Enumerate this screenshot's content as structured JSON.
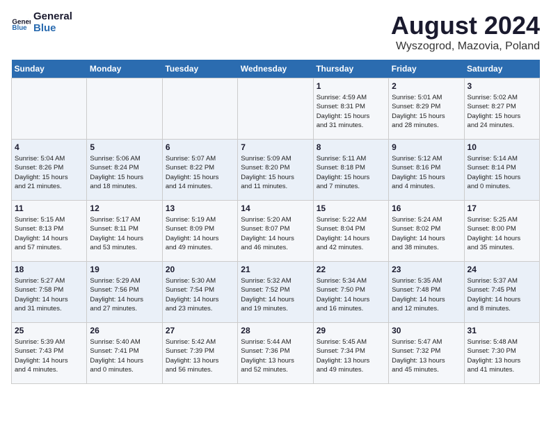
{
  "header": {
    "logo_line1": "General",
    "logo_line2": "Blue",
    "main_title": "August 2024",
    "sub_title": "Wyszogrod, Mazovia, Poland"
  },
  "weekdays": [
    "Sunday",
    "Monday",
    "Tuesday",
    "Wednesday",
    "Thursday",
    "Friday",
    "Saturday"
  ],
  "weeks": [
    [
      {
        "day": "",
        "info": ""
      },
      {
        "day": "",
        "info": ""
      },
      {
        "day": "",
        "info": ""
      },
      {
        "day": "",
        "info": ""
      },
      {
        "day": "1",
        "info": "Sunrise: 4:59 AM\nSunset: 8:31 PM\nDaylight: 15 hours\nand 31 minutes."
      },
      {
        "day": "2",
        "info": "Sunrise: 5:01 AM\nSunset: 8:29 PM\nDaylight: 15 hours\nand 28 minutes."
      },
      {
        "day": "3",
        "info": "Sunrise: 5:02 AM\nSunset: 8:27 PM\nDaylight: 15 hours\nand 24 minutes."
      }
    ],
    [
      {
        "day": "4",
        "info": "Sunrise: 5:04 AM\nSunset: 8:26 PM\nDaylight: 15 hours\nand 21 minutes."
      },
      {
        "day": "5",
        "info": "Sunrise: 5:06 AM\nSunset: 8:24 PM\nDaylight: 15 hours\nand 18 minutes."
      },
      {
        "day": "6",
        "info": "Sunrise: 5:07 AM\nSunset: 8:22 PM\nDaylight: 15 hours\nand 14 minutes."
      },
      {
        "day": "7",
        "info": "Sunrise: 5:09 AM\nSunset: 8:20 PM\nDaylight: 15 hours\nand 11 minutes."
      },
      {
        "day": "8",
        "info": "Sunrise: 5:11 AM\nSunset: 8:18 PM\nDaylight: 15 hours\nand 7 minutes."
      },
      {
        "day": "9",
        "info": "Sunrise: 5:12 AM\nSunset: 8:16 PM\nDaylight: 15 hours\nand 4 minutes."
      },
      {
        "day": "10",
        "info": "Sunrise: 5:14 AM\nSunset: 8:14 PM\nDaylight: 15 hours\nand 0 minutes."
      }
    ],
    [
      {
        "day": "11",
        "info": "Sunrise: 5:15 AM\nSunset: 8:13 PM\nDaylight: 14 hours\nand 57 minutes."
      },
      {
        "day": "12",
        "info": "Sunrise: 5:17 AM\nSunset: 8:11 PM\nDaylight: 14 hours\nand 53 minutes."
      },
      {
        "day": "13",
        "info": "Sunrise: 5:19 AM\nSunset: 8:09 PM\nDaylight: 14 hours\nand 49 minutes."
      },
      {
        "day": "14",
        "info": "Sunrise: 5:20 AM\nSunset: 8:07 PM\nDaylight: 14 hours\nand 46 minutes."
      },
      {
        "day": "15",
        "info": "Sunrise: 5:22 AM\nSunset: 8:04 PM\nDaylight: 14 hours\nand 42 minutes."
      },
      {
        "day": "16",
        "info": "Sunrise: 5:24 AM\nSunset: 8:02 PM\nDaylight: 14 hours\nand 38 minutes."
      },
      {
        "day": "17",
        "info": "Sunrise: 5:25 AM\nSunset: 8:00 PM\nDaylight: 14 hours\nand 35 minutes."
      }
    ],
    [
      {
        "day": "18",
        "info": "Sunrise: 5:27 AM\nSunset: 7:58 PM\nDaylight: 14 hours\nand 31 minutes."
      },
      {
        "day": "19",
        "info": "Sunrise: 5:29 AM\nSunset: 7:56 PM\nDaylight: 14 hours\nand 27 minutes."
      },
      {
        "day": "20",
        "info": "Sunrise: 5:30 AM\nSunset: 7:54 PM\nDaylight: 14 hours\nand 23 minutes."
      },
      {
        "day": "21",
        "info": "Sunrise: 5:32 AM\nSunset: 7:52 PM\nDaylight: 14 hours\nand 19 minutes."
      },
      {
        "day": "22",
        "info": "Sunrise: 5:34 AM\nSunset: 7:50 PM\nDaylight: 14 hours\nand 16 minutes."
      },
      {
        "day": "23",
        "info": "Sunrise: 5:35 AM\nSunset: 7:48 PM\nDaylight: 14 hours\nand 12 minutes."
      },
      {
        "day": "24",
        "info": "Sunrise: 5:37 AM\nSunset: 7:45 PM\nDaylight: 14 hours\nand 8 minutes."
      }
    ],
    [
      {
        "day": "25",
        "info": "Sunrise: 5:39 AM\nSunset: 7:43 PM\nDaylight: 14 hours\nand 4 minutes."
      },
      {
        "day": "26",
        "info": "Sunrise: 5:40 AM\nSunset: 7:41 PM\nDaylight: 14 hours\nand 0 minutes."
      },
      {
        "day": "27",
        "info": "Sunrise: 5:42 AM\nSunset: 7:39 PM\nDaylight: 13 hours\nand 56 minutes."
      },
      {
        "day": "28",
        "info": "Sunrise: 5:44 AM\nSunset: 7:36 PM\nDaylight: 13 hours\nand 52 minutes."
      },
      {
        "day": "29",
        "info": "Sunrise: 5:45 AM\nSunset: 7:34 PM\nDaylight: 13 hours\nand 49 minutes."
      },
      {
        "day": "30",
        "info": "Sunrise: 5:47 AM\nSunset: 7:32 PM\nDaylight: 13 hours\nand 45 minutes."
      },
      {
        "day": "31",
        "info": "Sunrise: 5:48 AM\nSunset: 7:30 PM\nDaylight: 13 hours\nand 41 minutes."
      }
    ]
  ]
}
